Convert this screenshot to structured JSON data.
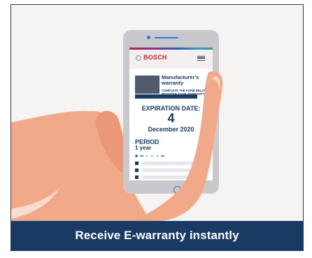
{
  "brand": {
    "logo_text": "BOSCH",
    "accent_color": "#183b63",
    "logo_color": "#d71e2b",
    "highlight_color": "#2a7ad7"
  },
  "phone_screen": {
    "warranty_title": "Manufacturer's warranty",
    "warranty_subtitle": "COMPLETE THE FORM BELOW TO REGISTER YOUR WARRANTY",
    "expiration_label": "EXPIRATION DATE:",
    "expiration_day": "4",
    "expiration_month_year": "December 2020",
    "period_label": "PERIOD",
    "period_value": "1 year",
    "menu_icon": "hamburger-menu-icon"
  },
  "banner": {
    "caption": "Receive E-warranty instantly"
  }
}
